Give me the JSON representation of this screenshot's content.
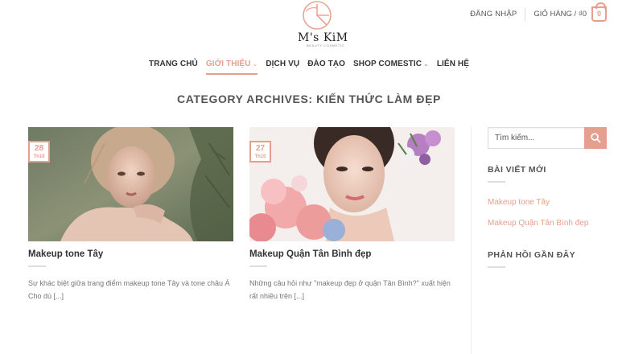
{
  "brand": {
    "name": "M's KiM",
    "tagline": "BEAUTY COSMETIC",
    "accent_color": "#e49f8e"
  },
  "header": {
    "login_label": "ĐĂNG NHẬP",
    "cart_label": "GIỎ HÀNG / ₫0",
    "cart_count": "0",
    "cart_icon": "shopping-bag-icon"
  },
  "nav": {
    "items": [
      {
        "label": "TRANG CHỦ"
      },
      {
        "label": "GIỚI THIỆU",
        "active": true,
        "has_dropdown": true
      },
      {
        "label": "DỊCH VỤ"
      },
      {
        "label": "ĐÀO TẠO"
      },
      {
        "label": "SHOP COMESTIC",
        "has_dropdown": true
      },
      {
        "label": "LIÊN HỆ"
      }
    ]
  },
  "archive_title": "CATEGORY ARCHIVES: KIẾN THỨC LÀM ĐẸP",
  "posts": [
    {
      "day": "28",
      "month": "Th10",
      "title": "Makeup tone Tây",
      "excerpt": "Sự khác biệt giữa trang điểm makeup tone Tây và tone châu Á Cho dù [...]"
    },
    {
      "day": "27",
      "month": "Th10",
      "title": "Makeup Quận Tân Bình đẹp",
      "excerpt": "Những câu hỏi như \"makeup đẹp ở quận Tân Bình?\" xuất hiện rất nhiều trên [...]"
    }
  ],
  "sidebar": {
    "search_placeholder": "Tìm kiếm...",
    "search_icon": "search-icon",
    "recent_posts_title": "BÀI VIẾT MỚI",
    "recent_posts": [
      {
        "label": "Makeup tone Tây"
      },
      {
        "label": "Makeup Quận Tân Bình đẹp"
      }
    ],
    "recent_comments_title": "PHẢN HỒI GẦN ĐÂY"
  }
}
